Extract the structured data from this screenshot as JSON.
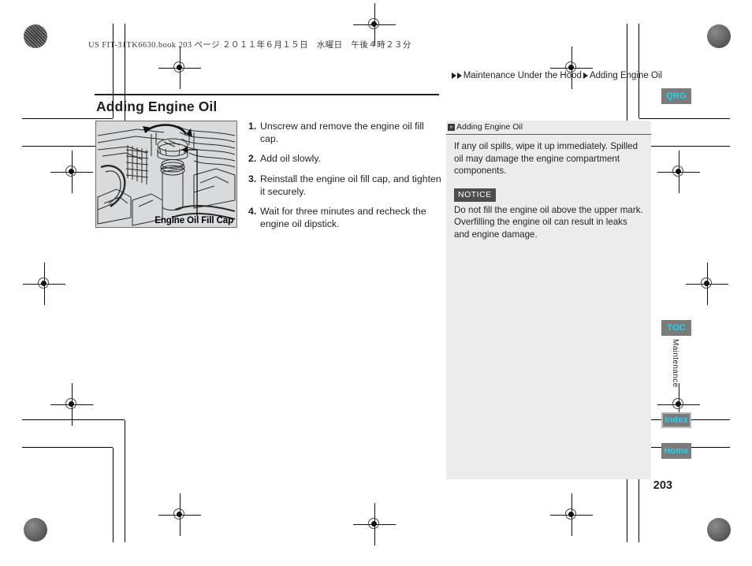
{
  "document": {
    "book_info": "US FIT-31TK6630.book  203 ページ  ２０１１年６月１５日　水曜日　午後４時２３分",
    "page_number": "203",
    "section_tab_label": "Maintenance"
  },
  "breadcrumb": {
    "arrow_icon": "triangle-right-icon",
    "items": [
      "Maintenance Under the Hood",
      "Adding Engine Oil"
    ]
  },
  "header": {
    "title": "Adding Engine Oil"
  },
  "figure": {
    "name": "engine-oil-fill-cap-illustration",
    "caption": "Engine Oil Fill Cap",
    "alt": "Engine compartment illustration showing the engine oil fill cap being unscrewed with a rotation arrow"
  },
  "steps": [
    {
      "num": "1.",
      "text": "Unscrew and remove the engine oil fill cap."
    },
    {
      "num": "2.",
      "text": "Add oil slowly."
    },
    {
      "num": "3.",
      "text": "Reinstall the engine oil fill cap, and tighten it securely."
    },
    {
      "num": "4.",
      "text": "Wait for three minutes and recheck the engine oil dipstick."
    }
  ],
  "side_panel": {
    "head_icon": "»",
    "head_title": "Adding Engine Oil",
    "paragraph": "If any oil spills, wipe it up immediately. Spilled oil may damage the engine compartment components.",
    "notice_label": "NOTICE",
    "notice_text": "Do not fill the engine oil above the upper mark. Overfilling the engine oil can result in leaks and engine damage."
  },
  "nav_tabs": [
    {
      "label": "QRG"
    },
    {
      "label": "TOC"
    },
    {
      "label": "Index"
    },
    {
      "label": "Home"
    }
  ],
  "colors": {
    "accent": "#22d3ee",
    "tab_background": "#7b7b7b",
    "panel_background": "#ececec",
    "text": "#231f20",
    "notice_badge": "#4d4d4d"
  }
}
